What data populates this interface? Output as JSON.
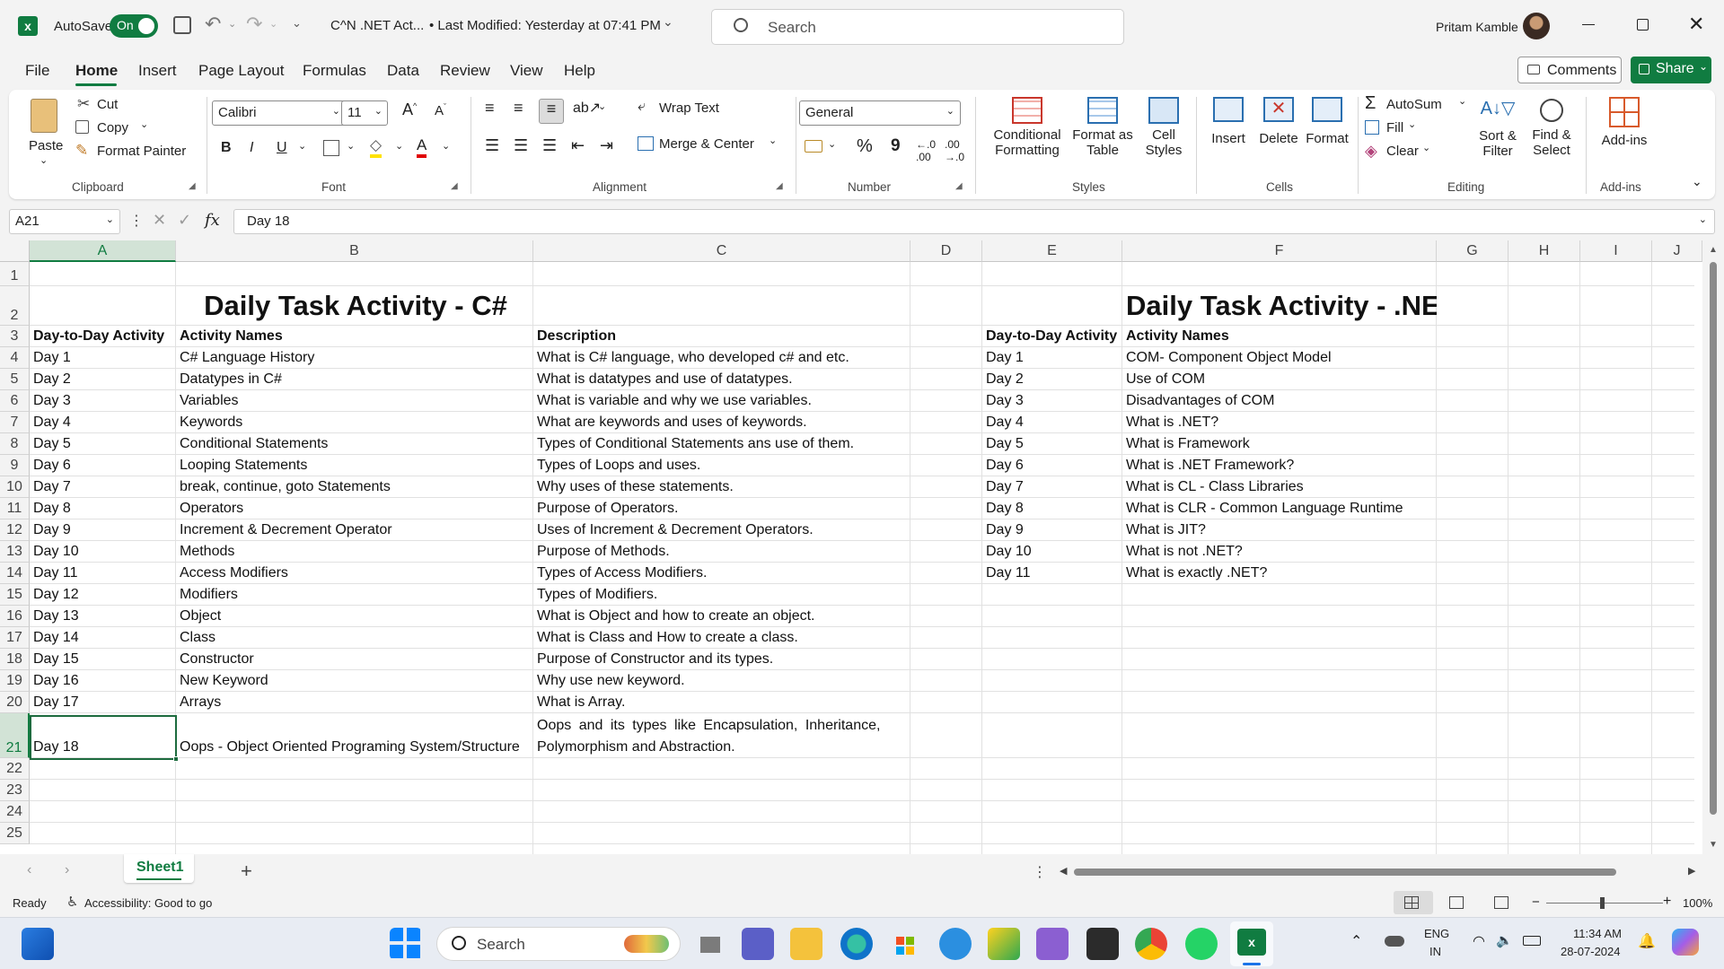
{
  "titlebar": {
    "autosave_label": "AutoSave",
    "autosave_state": "On",
    "file_title": "C^N .NET Act...",
    "modified": "• Last Modified: Yesterday at 07:41 PM",
    "search_placeholder": "Search",
    "user_name": "Pritam Kamble"
  },
  "menu": [
    "File",
    "Home",
    "Insert",
    "Page Layout",
    "Formulas",
    "Data",
    "Review",
    "View",
    "Help"
  ],
  "menu_active": "Home",
  "actions": {
    "comments": "Comments",
    "share": "Share"
  },
  "ribbon": {
    "clipboard": {
      "paste": "Paste",
      "cut": "Cut",
      "copy": "Copy",
      "format_painter": "Format Painter",
      "label": "Clipboard"
    },
    "font": {
      "name": "Calibri",
      "size": "11",
      "bold": "B",
      "italic": "I",
      "underline": "U",
      "label": "Font"
    },
    "alignment": {
      "wrap": "Wrap Text",
      "merge": "Merge & Center",
      "label": "Alignment"
    },
    "number": {
      "format": "General",
      "percent": "%",
      "comma": "9",
      "label": "Number"
    },
    "styles": {
      "cond1": "Conditional",
      "cond2": "Formatting",
      "fmt1": "Format as",
      "fmt2": "Table",
      "cell1": "Cell",
      "cell2": "Styles",
      "label": "Styles"
    },
    "cells": {
      "insert": "Insert",
      "delete": "Delete",
      "format": "Format",
      "label": "Cells"
    },
    "editing": {
      "autosum": "AutoSum",
      "fill": "Fill",
      "clear": "Clear",
      "sort1": "Sort &",
      "sort2": "Filter",
      "find1": "Find &",
      "find2": "Select",
      "label": "Editing"
    },
    "addins": {
      "addins": "Add-ins",
      "label": "Add-ins"
    }
  },
  "formula_bar": {
    "name_box": "A21",
    "fx": "fx",
    "content": "Day 18"
  },
  "columns": [
    "A",
    "B",
    "C",
    "D",
    "E",
    "F",
    "G",
    "H",
    "I",
    "J"
  ],
  "rows": [
    "1",
    "2",
    "3",
    "4",
    "5",
    "6",
    "7",
    "8",
    "9",
    "10",
    "11",
    "12",
    "13",
    "14",
    "15",
    "16",
    "17",
    "18",
    "19",
    "20",
    "21",
    "22",
    "23",
    "24",
    "25"
  ],
  "sheet": {
    "title_csharp": "Daily Task Activity - C#",
    "title_net": "Daily Task Activity - .NET",
    "headers_left": [
      "Day-to-Day Activity",
      "Activity Names",
      "Description"
    ],
    "headers_right": [
      "Day-to-Day Activity",
      "Activity Names"
    ],
    "left_rows": [
      [
        "Day 1",
        "C# Language History",
        "What is C# language, who developed c# and etc."
      ],
      [
        "Day 2",
        "Datatypes in C#",
        "What is datatypes and use of datatypes."
      ],
      [
        "Day 3",
        "Variables",
        "What is variable and why we use variables."
      ],
      [
        "Day 4",
        "Keywords",
        "What are keywords and uses of keywords."
      ],
      [
        "Day 5",
        "Conditional Statements",
        "Types of Conditional Statements ans use of them."
      ],
      [
        "Day 6",
        "Looping Statements",
        "Types of Loops and uses."
      ],
      [
        "Day 7",
        "break, continue, goto Statements",
        "Why uses of these statements."
      ],
      [
        "Day 8",
        "Operators",
        "Purpose of Operators."
      ],
      [
        "Day 9",
        "Increment & Decrement Operator",
        "Uses of Increment & Decrement Operators."
      ],
      [
        "Day 10",
        "Methods",
        "Purpose of Methods."
      ],
      [
        "Day 11",
        "Access Modifiers",
        "Types of Access Modifiers."
      ],
      [
        "Day 12",
        "Modifiers",
        "Types of Modifiers."
      ],
      [
        "Day 13",
        "Object",
        "What is Object and how to create an object."
      ],
      [
        "Day 14",
        "Class",
        "What is Class and How to create a class."
      ],
      [
        "Day 15",
        "Constructor",
        "Purpose of Constructor and its types."
      ],
      [
        "Day 16",
        "New Keyword",
        "Why use new keyword."
      ],
      [
        "Day 17",
        "Arrays",
        "What is Array."
      ]
    ],
    "row21": {
      "a": "Day 18",
      "b": "Oops - Object Oriented Programing System/Structure",
      "c1": "Oops and its types like Encapsulation, Inheritance,",
      "c2": "Polymorphism and Abstraction."
    },
    "right_rows": [
      [
        "Day 1",
        "COM- Component Object Model"
      ],
      [
        "Day 2",
        "Use of COM"
      ],
      [
        "Day 3",
        "Disadvantages of COM"
      ],
      [
        "Day 4",
        "What is .NET?"
      ],
      [
        "Day 5",
        "What is Framework"
      ],
      [
        "Day 6",
        "What is .NET Framework?"
      ],
      [
        "Day 7",
        "What is CL - Class Libraries"
      ],
      [
        "Day 8",
        "What is CLR - Common Language Runtime"
      ],
      [
        "Day 9",
        "What is JIT?"
      ],
      [
        "Day 10",
        "What is not .NET?"
      ],
      [
        "Day 11",
        "What is exactly .NET?"
      ]
    ]
  },
  "sheet_tab": "Sheet1",
  "status": {
    "ready": "Ready",
    "accessibility": "Accessibility: Good to go",
    "zoom": "100%"
  },
  "taskbar": {
    "search": "Search",
    "lang1": "ENG",
    "lang2": "IN",
    "time": "11:34 AM",
    "date": "28-07-2024"
  },
  "colors": {
    "excel_green": "#107c41",
    "selection": "#1d6b3e",
    "accent": "#217346"
  }
}
